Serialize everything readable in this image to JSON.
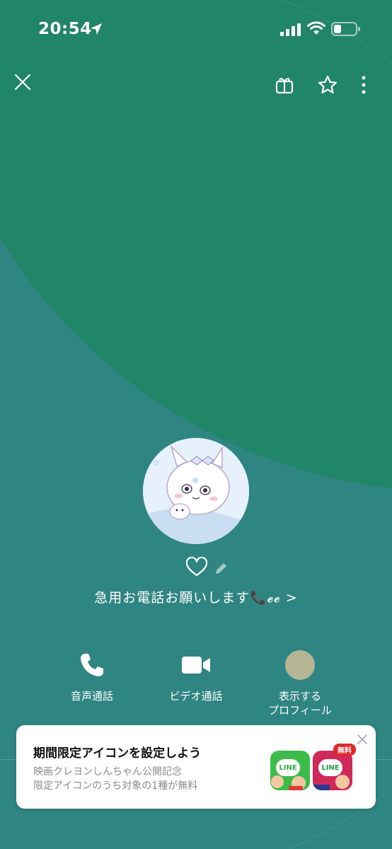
{
  "status_bar": {
    "time": "20:54"
  },
  "profile": {
    "status_message": "急用お電話お願いします📞𝓮𝓮 >"
  },
  "actions": {
    "voice_call": "音声通話",
    "video_call": "ビデオ通話",
    "show_profile": "表示する\nプロフィール"
  },
  "banner": {
    "title": "期間限定アイコンを設定しよう",
    "line1": "映画クレヨンしんちゃん公開記念",
    "line2": "限定アイコンのうち対象の1種が無料",
    "app1_label": "LINE",
    "app2_label": "LINE",
    "free_badge": "無料"
  },
  "colors": {
    "top_green": "#218567",
    "bottom_teal": "#2f8582",
    "profile_dot": "#b5b596"
  }
}
